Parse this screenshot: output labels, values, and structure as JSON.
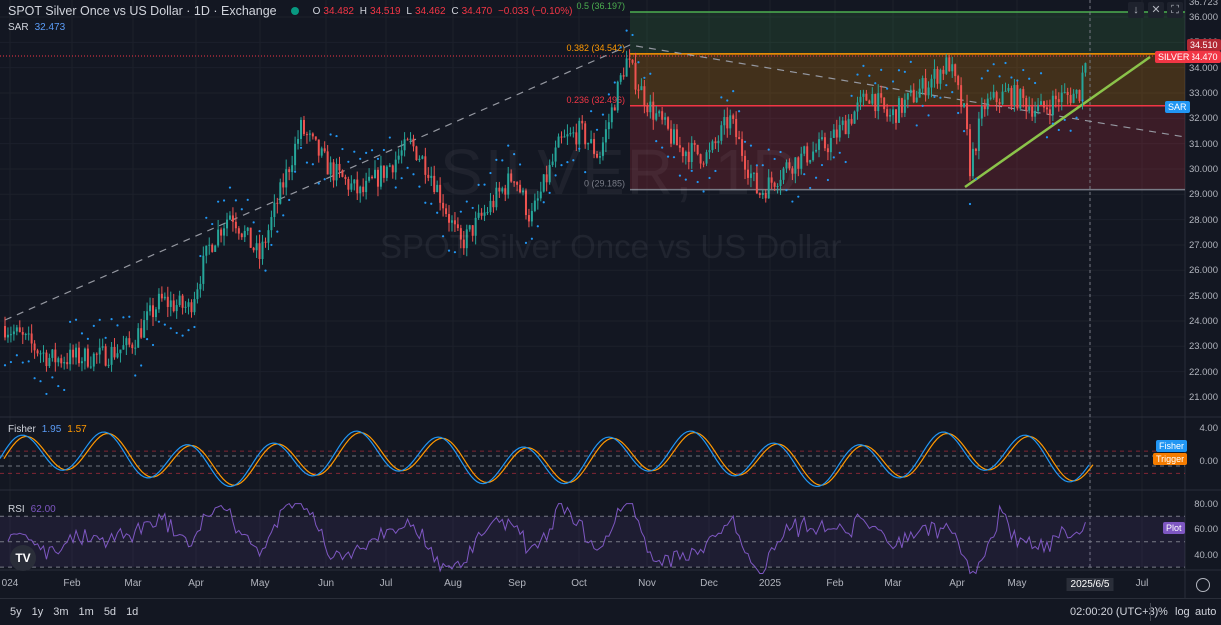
{
  "header": {
    "title": "SPOT Silver Once vs US Dollar · 1D · Exchange",
    "o_label": "O",
    "o": "34.482",
    "h_label": "H",
    "h": "34.519",
    "l_label": "L",
    "l": "34.462",
    "c_label": "C",
    "c": "34.470",
    "change": "−0.033 (−0.10%)"
  },
  "sar": {
    "label": "SAR",
    "value": "32.473"
  },
  "fisher": {
    "label": "Fisher",
    "fisher": "1.95",
    "trigger": "1.57",
    "tag_fisher": "Fisher",
    "tag_trigger": "Trigger"
  },
  "rsi": {
    "label": "RSI",
    "value": "62.00",
    "tag": "Plot"
  },
  "watermark": {
    "symbol": "SILVER, 1D",
    "name": "SPOT Silver Once vs US Dollar"
  },
  "fib": [
    {
      "label": "0.5 (36.197)",
      "price": 36.197,
      "color": "#4caf50"
    },
    {
      "label": "0.382 (34.542)",
      "price": 34.542,
      "color": "#ff9800"
    },
    {
      "label": "0.236 (32.496)",
      "price": 32.496,
      "color": "#f23645"
    },
    {
      "label": "0 (29.185)",
      "price": 29.185,
      "color": "#787b86"
    }
  ],
  "price_axis": [
    "36.000",
    "35.000",
    "34.000",
    "33.000",
    "32.000",
    "31.000",
    "30.000",
    "29.000",
    "28.000",
    "27.000",
    "26.000",
    "25.000",
    "24.000",
    "23.000",
    "22.000",
    "21.000"
  ],
  "price_axis_top": "36.723",
  "price_tags": {
    "high": "34.510",
    "last": "34.470",
    "symbol": "SILVER",
    "sar": "SAR"
  },
  "fisher_axis": [
    "4.00",
    "0.00"
  ],
  "rsi_axis": [
    "80.00",
    "60.00",
    "40.00"
  ],
  "time_axis": [
    "024",
    "Feb",
    "Mar",
    "Apr",
    "May",
    "Jun",
    "Jul",
    "Aug",
    "Sep",
    "Oct",
    "Nov",
    "Dec",
    "2025",
    "Feb",
    "Mar",
    "Apr",
    "May",
    "2025/6/5",
    "Jul"
  ],
  "bottom": {
    "timeframes": [
      "5y",
      "1y",
      "3m",
      "1m",
      "5d",
      "1d"
    ],
    "clock": "02:00:20 (UTC+3)",
    "percent": "%",
    "log": "log",
    "auto": "auto"
  },
  "toolbar": {
    "down": "↓",
    "collapse": "✕",
    "fullscreen": "⛶"
  },
  "colors": {
    "up": "#26a69a",
    "down": "#ef5350",
    "sar": "#2196f3",
    "fisher": "#2196f3",
    "trigger": "#ff9800",
    "rsi": "#7e57c2"
  },
  "chart_data": {
    "type": "candlestick",
    "title": "SPOT Silver Once vs US Dollar · 1D",
    "ylim": [
      20.5,
      36.7
    ],
    "price_path_day_close": [
      [
        0,
        23.8
      ],
      [
        22,
        22.5
      ],
      [
        46,
        22.6
      ],
      [
        60,
        23
      ],
      [
        75,
        24.8
      ],
      [
        89,
        24.5
      ],
      [
        99,
        27
      ],
      [
        109,
        28.3
      ],
      [
        123,
        26.5
      ],
      [
        143,
        31.6
      ],
      [
        157,
        30
      ],
      [
        172,
        29
      ],
      [
        196,
        31
      ],
      [
        205,
        30
      ],
      [
        220,
        27
      ],
      [
        234,
        28.5
      ],
      [
        246,
        29.8
      ],
      [
        254,
        28
      ],
      [
        268,
        31
      ],
      [
        278,
        31.5
      ],
      [
        287,
        30.5
      ],
      [
        300,
        34.3
      ],
      [
        311,
        32.5
      ],
      [
        326,
        30.8
      ],
      [
        340,
        30.5
      ],
      [
        350,
        32
      ],
      [
        364,
        29
      ],
      [
        379,
        30.2
      ],
      [
        398,
        31
      ],
      [
        418,
        33
      ],
      [
        427,
        32
      ],
      [
        447,
        33.5
      ],
      [
        456,
        34.2
      ],
      [
        464,
        32
      ],
      [
        466,
        30
      ],
      [
        473,
        32.5
      ],
      [
        485,
        33
      ],
      [
        500,
        32.3
      ],
      [
        509,
        32.8
      ],
      [
        519,
        33
      ],
      [
        522,
        34.47
      ]
    ]
  }
}
